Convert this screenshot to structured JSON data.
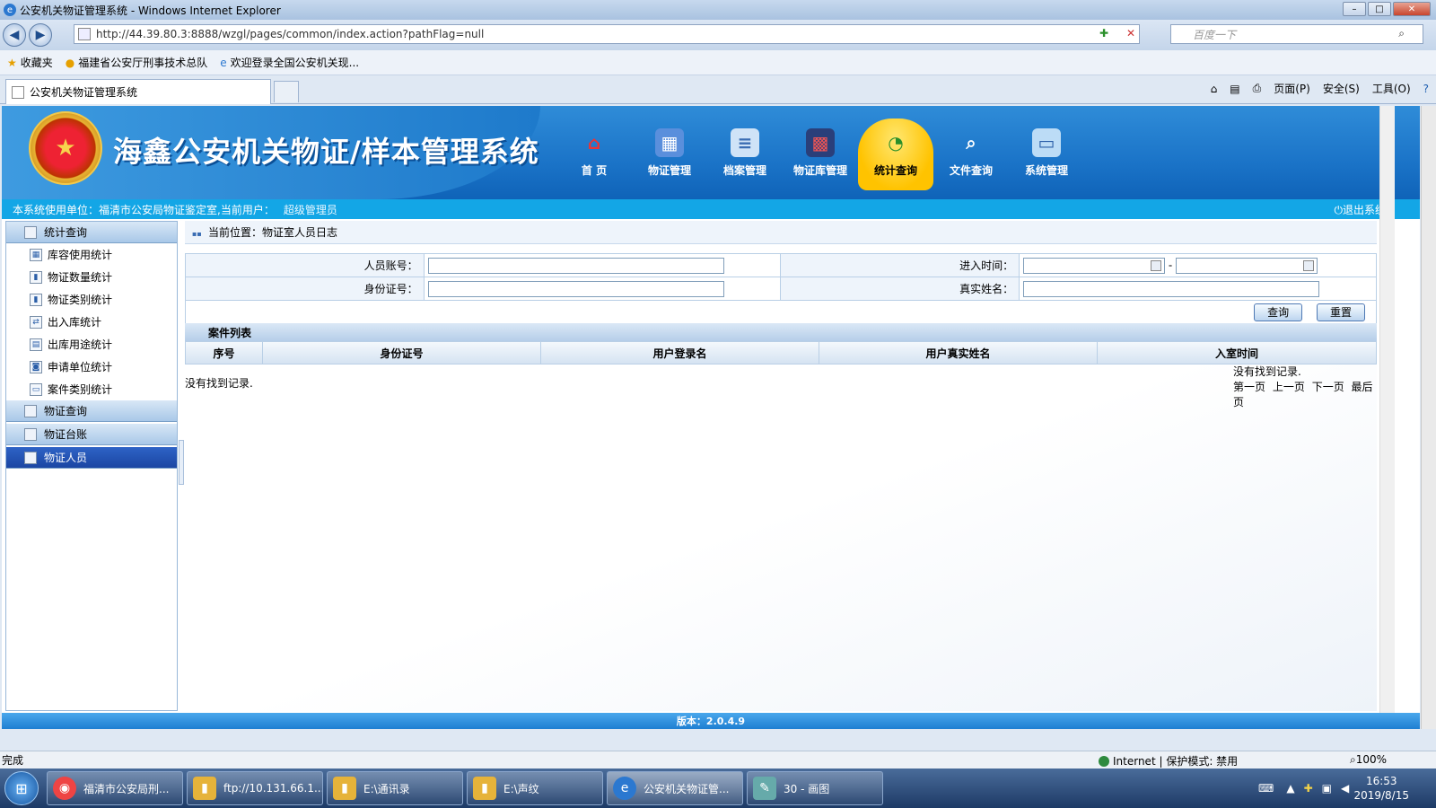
{
  "window": {
    "title": "公安机关物证管理系统 - Windows Internet Explorer"
  },
  "browser": {
    "address": "http://44.39.80.3:8888/wzgl/pages/common/index.action?pathFlag=null",
    "search_placeholder": "百度一下",
    "favorites_label": "收藏夹",
    "favorites": [
      "福建省公安厅刑事技术总队",
      "欢迎登录全国公安机关现..."
    ],
    "tab_title": "公安机关物证管理系统",
    "commands": [
      "页面(P)",
      "安全(S)",
      "工具(O)"
    ]
  },
  "app": {
    "title": "海鑫公安机关物证/样本管理系统",
    "nav": [
      {
        "label": "首 页",
        "icon": "home-icon"
      },
      {
        "label": "物证管理",
        "icon": "evidence-icon"
      },
      {
        "label": "档案管理",
        "icon": "archive-icon"
      },
      {
        "label": "物证库管理",
        "icon": "warehouse-icon"
      },
      {
        "label": "统计查询",
        "icon": "stats-icon",
        "active": true
      },
      {
        "label": "文件查询",
        "icon": "file-search-icon"
      },
      {
        "label": "系统管理",
        "icon": "system-icon"
      }
    ],
    "user_info": "本系统使用单位：福清市公安局物证鉴定室,当前用户：",
    "user_name": "超级管理员",
    "logout": "退出系统",
    "version": "版本：2.0.4.9"
  },
  "sidebar": {
    "groups": [
      {
        "label": "统计查询",
        "items": [
          "库容使用统计",
          "物证数量统计",
          "物证类别统计",
          "出入库统计",
          "出库用途统计",
          "申请单位统计",
          "案件类别统计"
        ]
      },
      {
        "label": "物证查询"
      },
      {
        "label": "物证台账"
      },
      {
        "label": "物证人员",
        "active": true
      }
    ]
  },
  "content": {
    "breadcrumb": "当前位置：物证室人员日志",
    "form": {
      "account_label": "人员账号：",
      "account_value": "",
      "time_label": "进入时间：",
      "time_sep": "-",
      "id_label": "身份证号：",
      "id_value": "",
      "name_label": "真实姓名：",
      "name_value": "",
      "query_btn": "查询",
      "reset_btn": "重置"
    },
    "list_title": "案件列表",
    "columns": [
      "序号",
      "身份证号",
      "用户登录名",
      "用户真实姓名",
      "入室时间"
    ],
    "no_records": "没有找到记录.",
    "pager": {
      "no_records": "没有找到记录.",
      "first": "第一页",
      "prev": "上一页",
      "next": "下一页",
      "last": "最后页"
    }
  },
  "status": {
    "text": "完成",
    "zone": "Internet | 保护模式: 禁用",
    "zoom": "100%"
  },
  "taskbar": {
    "tasks": [
      {
        "label": "福清市公安局刑...",
        "icon": "chrome-icon",
        "color": "#e44"
      },
      {
        "label": "ftp://10.131.66.1...",
        "icon": "folder-icon",
        "color": "#e6b33a"
      },
      {
        "label": "E:\\通讯录",
        "icon": "folder-icon",
        "color": "#e6b33a"
      },
      {
        "label": "E:\\声纹",
        "icon": "folder-icon",
        "color": "#e6b33a"
      },
      {
        "label": "公安机关物证管...",
        "icon": "ie-icon",
        "color": "#2b78d0",
        "active": true
      },
      {
        "label": "30 - 画图",
        "icon": "paint-icon",
        "color": "#6aa"
      }
    ],
    "time": "16:53",
    "date": "2019/8/15"
  }
}
